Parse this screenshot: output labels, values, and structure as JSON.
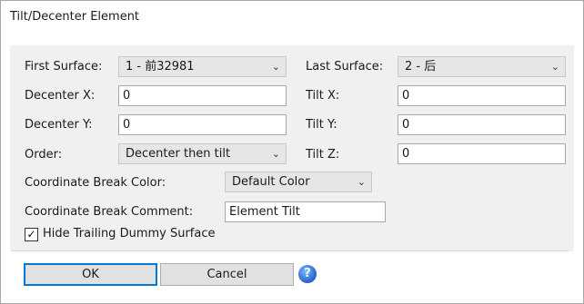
{
  "window": {
    "title": "Tilt/Decenter Element"
  },
  "form": {
    "first_surface": {
      "label": "First Surface:",
      "value": "1 - 前32981"
    },
    "last_surface": {
      "label": "Last Surface:",
      "value": "2 - 后"
    },
    "decenter_x": {
      "label": "Decenter X:",
      "value": "0"
    },
    "tilt_x": {
      "label": "Tilt X:",
      "value": "0"
    },
    "decenter_y": {
      "label": "Decenter Y:",
      "value": "0"
    },
    "tilt_y": {
      "label": "Tilt Y:",
      "value": "0"
    },
    "order": {
      "label": "Order:",
      "value": "Decenter then tilt"
    },
    "tilt_z": {
      "label": "Tilt Z:",
      "value": "0"
    },
    "coord_break_color": {
      "label": "Coordinate Break Color:",
      "value": "Default Color"
    },
    "coord_break_comment": {
      "label": "Coordinate Break Comment:",
      "value": "Element Tilt"
    },
    "hide_trailing": {
      "label": "Hide Trailing Dummy Surface",
      "checked": true,
      "mark": "✓"
    }
  },
  "buttons": {
    "ok": "OK",
    "cancel": "Cancel",
    "help": "?"
  },
  "icons": {
    "dropdown": "chevron-down-icon",
    "help": "help-icon",
    "check": "checkmark-icon"
  },
  "colors": {
    "panel": "#f0f0f0",
    "dropdown_bg": "#e6e6e6",
    "default_button_border": "#0078d7",
    "help_icon": "#2f6fd0"
  }
}
